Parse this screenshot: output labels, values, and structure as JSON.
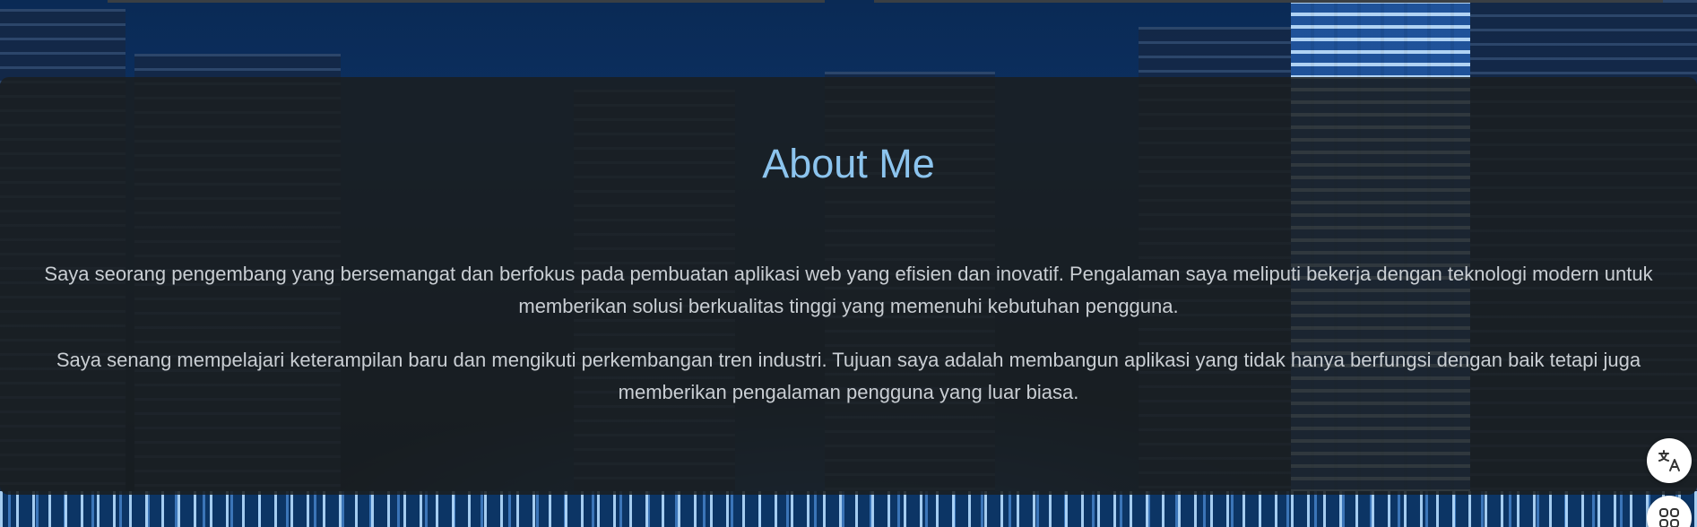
{
  "about": {
    "title": "About Me",
    "paragraphs": [
      "Saya seorang pengembang yang bersemangat dan berfokus pada pembuatan aplikasi web yang efisien dan inovatif. Pengalaman saya meliputi bekerja dengan teknologi modern untuk memberikan solusi berkualitas tinggi yang memenuhi kebutuhan pengguna.",
      "Saya senang mempelajari keterampilan baru dan mengikuti perkembangan tren industri. Tujuan saya adalah membangun aplikasi yang tidak hanya berfungsi dengan baik tetapi juga memberikan pengalaman pengguna yang luar biasa."
    ]
  },
  "floating_buttons": {
    "translate_icon": "translate-icon",
    "apps_icon": "apps-grid-icon"
  },
  "colors": {
    "title": "#8cc4ee",
    "text": "#c9ced3",
    "card_background": "#1b1e20",
    "page_background": "#0b1d33"
  }
}
